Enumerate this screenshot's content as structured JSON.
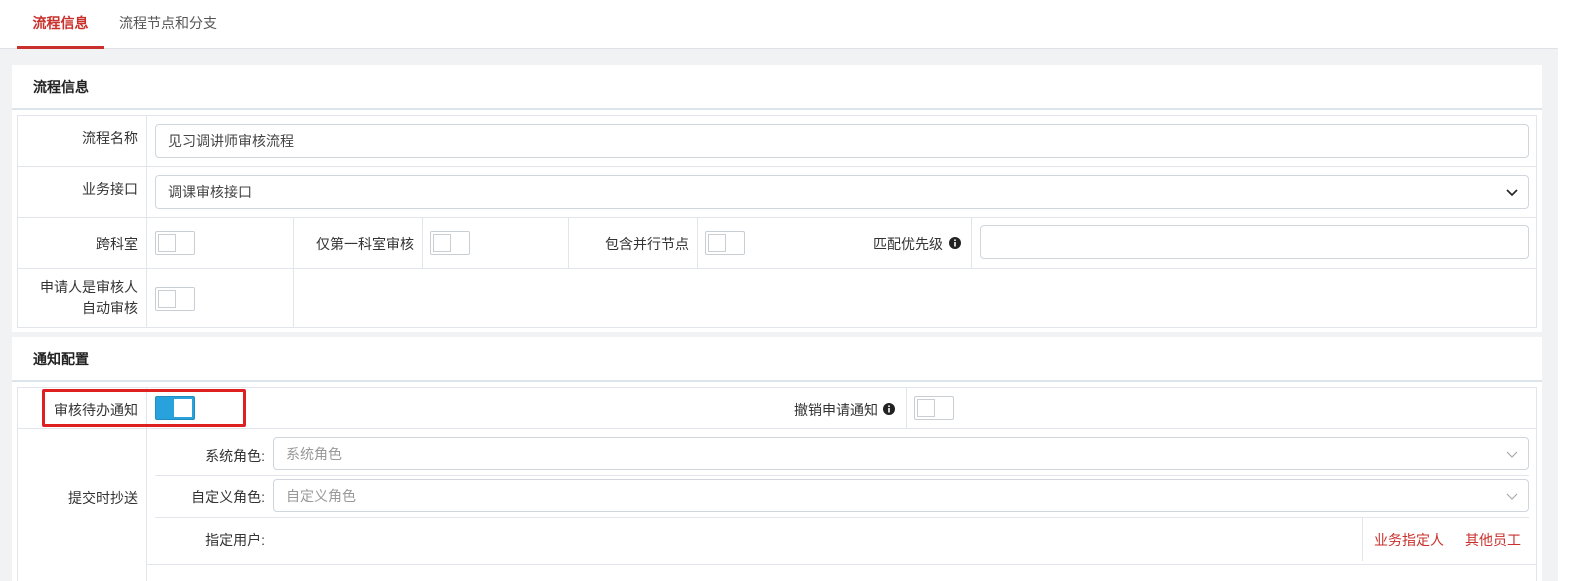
{
  "tabs": [
    {
      "label": "流程信息"
    },
    {
      "label": "流程节点和分支"
    }
  ],
  "flow_info": {
    "title": "流程信息",
    "name_label": "流程名称",
    "name_value": "见习调讲师审核流程",
    "interface_label": "业务接口",
    "interface_value": "调课审核接口",
    "cross_dept_label": "跨科室",
    "cross_dept_on": false,
    "first_dept_label": "仅第一科室审核",
    "first_dept_on": false,
    "parallel_label": "包含并行节点",
    "parallel_on": false,
    "priority_label": "匹配优先级",
    "priority_value": "",
    "auto_review_label_line1": "申请人是审核人",
    "auto_review_label_line2": "自动审核",
    "auto_review_on": false
  },
  "notify": {
    "title": "通知配置",
    "pending_label": "审核待办通知",
    "pending_on": true,
    "revoke_label": "撤销申请通知",
    "revoke_on": false,
    "cc_label": "提交时抄送",
    "system_role_label": "系统角色:",
    "system_role_placeholder": "系统角色",
    "custom_role_label": "自定义角色:",
    "custom_role_placeholder": "自定义角色",
    "user_label": "指定用户:",
    "business_assignee_link": "业务指定人",
    "other_staff_link": "其他员工"
  },
  "colors": {
    "accent_red": "#c9302c",
    "toggle_on": "#27a2dc",
    "highlight": "#e02020"
  }
}
